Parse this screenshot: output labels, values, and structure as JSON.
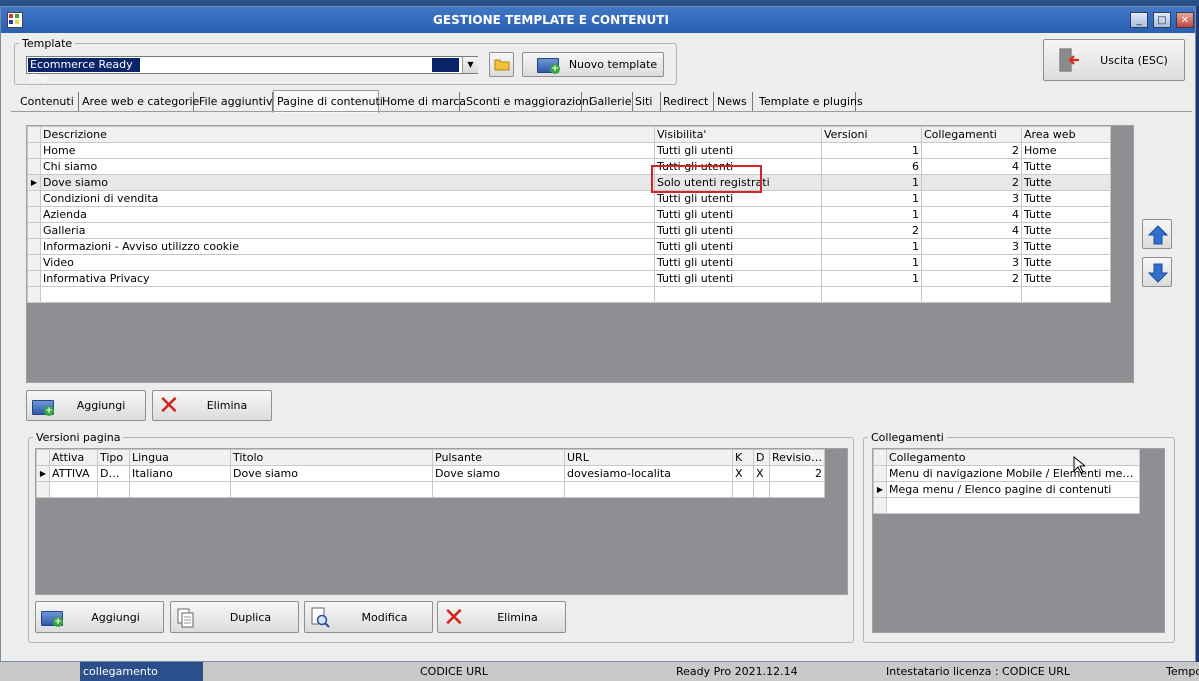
{
  "background": {
    "bottom_cells": [
      "collegamento",
      "CODICE URL",
      "Ready Pro 2021.12.14",
      "Intestatario licenza : CODICE URL",
      "Tempo"
    ]
  },
  "window": {
    "title": "GESTIONE TEMPLATE E CONTENUTI",
    "controls": [
      "_",
      "□",
      "✕"
    ]
  },
  "template": {
    "group_label": "Template",
    "selected": "Ecommerce Ready Pro",
    "new_button": "Nuovo template"
  },
  "exit_button": "Uscita (ESC)",
  "tabs": [
    {
      "label": "Contenuti"
    },
    {
      "label": "Aree web e categorie"
    },
    {
      "label": "File aggiuntivi"
    },
    {
      "label": "Pagine di contenuti"
    },
    {
      "label": "Home di marca"
    },
    {
      "label": "Sconti e maggiorazioni"
    },
    {
      "label": "Gallerie"
    },
    {
      "label": "Siti"
    },
    {
      "label": "Redirect"
    },
    {
      "label": "News"
    },
    {
      "label": "Template e plugins"
    }
  ],
  "active_tab": "Pagine di contenuti",
  "pages": {
    "columns": [
      "Descrizione",
      "Visibilita'",
      "Versioni",
      "Collegamenti",
      "Area web"
    ],
    "rows": [
      {
        "desc": "Home",
        "vis": "Tutti gli utenti",
        "ver": "1",
        "coll": "2",
        "area": "Home"
      },
      {
        "desc": "Chi siamo",
        "vis": "Tutti gli utenti",
        "ver": "6",
        "coll": "4",
        "area": "Tutte"
      },
      {
        "desc": "Dove siamo",
        "vis": "Solo utenti registrati",
        "ver": "1",
        "coll": "2",
        "area": "Tutte"
      },
      {
        "desc": "Condizioni di vendita",
        "vis": "Tutti gli utenti",
        "ver": "1",
        "coll": "3",
        "area": "Tutte"
      },
      {
        "desc": "Azienda",
        "vis": "Tutti gli utenti",
        "ver": "1",
        "coll": "4",
        "area": "Tutte"
      },
      {
        "desc": "Galleria",
        "vis": "Tutti gli utenti",
        "ver": "2",
        "coll": "4",
        "area": "Tutte"
      },
      {
        "desc": "Informazioni - Avviso utilizzo cookie",
        "vis": "Tutti gli utenti",
        "ver": "1",
        "coll": "3",
        "area": "Tutte"
      },
      {
        "desc": "Video",
        "vis": "Tutti gli utenti",
        "ver": "1",
        "coll": "3",
        "area": "Tutte"
      },
      {
        "desc": "Informativa Privacy",
        "vis": "Tutti gli utenti",
        "ver": "1",
        "coll": "2",
        "area": "Tutte"
      }
    ],
    "selected_row": 2,
    "add_button": "Aggiungi",
    "delete_button": "Elimina"
  },
  "versions": {
    "group_label": "Versioni pagina",
    "columns": [
      "Attiva",
      "Tipo",
      "Lingua",
      "Titolo",
      "Pulsante",
      "URL",
      "K",
      "D",
      "Revisione"
    ],
    "rows": [
      {
        "attiva": "ATTIVA",
        "tipo": "D+M",
        "lingua": "Italiano",
        "titolo": "Dove siamo",
        "pulsante": "Dove siamo",
        "url": "dovesiamo-localita",
        "k": "X",
        "d": "X",
        "rev": "2"
      }
    ],
    "add_button": "Aggiungi",
    "duplicate_button": "Duplica",
    "edit_button": "Modifica",
    "delete_button": "Elimina"
  },
  "links": {
    "group_label": "Collegamenti",
    "column": "Collegamento",
    "rows": [
      "Menu di navigazione Mobile / Elementi menu di na...",
      "Mega menu / Elenco pagine di contenuti"
    ]
  }
}
